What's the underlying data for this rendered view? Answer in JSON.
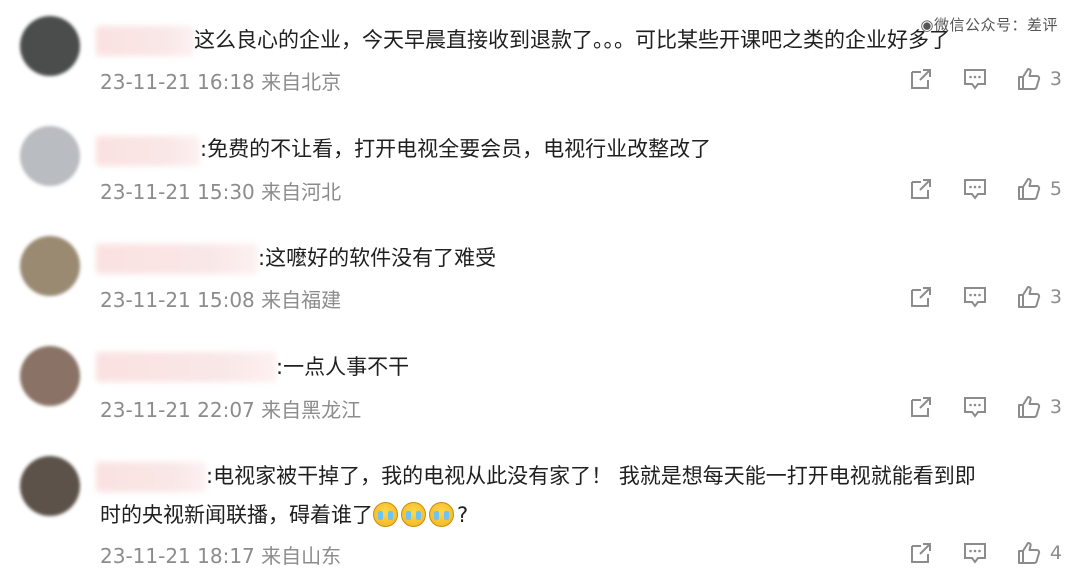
{
  "watermark": "◉微信公众号：差评",
  "comments": [
    {
      "text": "这么良心的企业，今天早晨直接收到退款了。。。可比某些开课吧之类的企业好多了",
      "meta": "23-11-21 16:18 来自北京",
      "likes": "3",
      "avatar_color": "#4a4d4b"
    },
    {
      "text": ":免费的不让看，打开电视全要会员，电视行业改整改了",
      "meta": "23-11-21 15:30 来自河北",
      "likes": "5",
      "avatar_color": "#b9bcc0"
    },
    {
      "text": ":这嚒好的软件没有了难受",
      "meta": "23-11-21 15:08 来自福建",
      "likes": "3",
      "avatar_color": "#9a8a72"
    },
    {
      "text": ":一点人事不干",
      "meta": "23-11-21 22:07 来自黑龙江",
      "likes": "3",
      "avatar_color": "#8a7366"
    },
    {
      "text": ":电视家被干掉了，我的电视从此没有家了！ 我就是想每天能一打开电视就能看到即",
      "text2": "时的央视新闻联播，碍着谁了",
      "text2_end": "?",
      "meta": "23-11-21 18:17 来自山东",
      "likes": "4",
      "avatar_color": "#5c5249"
    }
  ],
  "icons": {
    "share": "share-icon",
    "comment": "comment-icon",
    "like": "thumbs-up-icon",
    "emoji": "crying-face-icon"
  }
}
